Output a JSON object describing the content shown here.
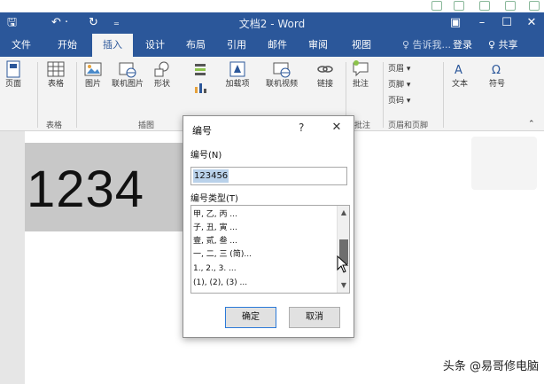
{
  "window": {
    "title": "文档2 - Word",
    "qa_save": "🖫",
    "qa_undo": "↶ ·",
    "qa_redo": "↻",
    "qa_customize": "₌",
    "display_options": "▣",
    "minimize": "–",
    "maximize": "☐",
    "close": "✕"
  },
  "menu": {
    "tabs": [
      "文件",
      "开始",
      "插入",
      "设计",
      "布局",
      "引用",
      "邮件",
      "审阅",
      "视图"
    ],
    "active_index": 2,
    "tell_me": "♀ 告诉我...",
    "login": "登录",
    "share": "♀ 共享"
  },
  "ribbon": {
    "cover_page": "页面",
    "table": "表格",
    "picture": "图片",
    "online_picture": "联机图片",
    "shapes": "形状",
    "addins": "加载项",
    "online_video": "联机视频",
    "link": "链接",
    "comment": "批注",
    "header": "页眉 ▾",
    "footer": "页脚 ▾",
    "page_number": "页码 ▾",
    "textbox": "文本",
    "symbol": "符号",
    "group_table": "表格",
    "group_illustrations": "插图",
    "group_comments": "批注",
    "group_header_footer": "页眉和页脚"
  },
  "document": {
    "digits": "1234"
  },
  "watermark": "头条 @易哥修电脑",
  "dialog": {
    "title": "编号",
    "help": "?",
    "close": "✕",
    "number_label": "编号(N)",
    "number_value": "123456",
    "type_label": "编号类型(T)",
    "types": [
      "甲, 乙, 丙 ...",
      "子, 丑, 寅 ...",
      "壹, 贰, 叁 ...",
      "一, 二, 三 (简)...",
      "1., 2., 3. ...",
      "(1), (2), (3) ..."
    ],
    "ok": "确定",
    "cancel": "取消"
  },
  "colors": {
    "brand": "#2b579a",
    "selection": "#b9d1ea"
  }
}
